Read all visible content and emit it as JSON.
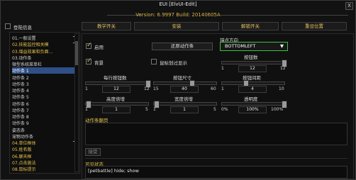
{
  "window": {
    "title": "EUI [ElvUI-Edit]",
    "close_label": "X",
    "version": "Version: 6.9997 Build: 20140605A"
  },
  "toggle_anchors": {
    "label": "登陆信息"
  },
  "top_buttons": [
    "教学开关",
    "安装",
    "解锁开关",
    "重设位置"
  ],
  "nav": {
    "items": [
      {
        "label": "01.一般设置",
        "color": "white",
        "plus": true
      },
      {
        "label": "02.技能监控相关模",
        "color": "yellow",
        "plus": true
      },
      {
        "label": "03.增益效果和负面...",
        "color": "yellow",
        "plus": false
      },
      {
        "label": "03.动作条",
        "color": "white",
        "plus": false
      },
      {
        "label": "微型系统菜单栏",
        "color": "white",
        "plus": false
      },
      {
        "label": "动作条 1",
        "color": "white",
        "plus": false,
        "selected": true
      },
      {
        "label": "动作条 2",
        "color": "white",
        "plus": false
      },
      {
        "label": "动作条 3",
        "color": "white",
        "plus": false
      },
      {
        "label": "动作条 4",
        "color": "white",
        "plus": false
      },
      {
        "label": "动作条 5",
        "color": "white",
        "plus": false
      },
      {
        "label": "动作条 6",
        "color": "white",
        "plus": false
      },
      {
        "label": "动作条 7",
        "color": "white",
        "plus": false
      },
      {
        "label": "动作条 8",
        "color": "white",
        "plus": false
      },
      {
        "label": "动作条 9",
        "color": "white",
        "plus": false
      },
      {
        "label": "姿态条",
        "color": "white",
        "plus": false
      },
      {
        "label": "宠物动作条",
        "color": "white",
        "plus": false
      },
      {
        "label": "04.单位框体",
        "color": "yellow",
        "plus": true
      },
      {
        "label": "05.姓名版",
        "color": "yellow",
        "plus": false
      },
      {
        "label": "06.聊天框",
        "color": "yellow",
        "plus": false
      },
      {
        "label": "07.点击施法",
        "color": "yellow",
        "plus": false
      },
      {
        "label": "08.鼠标提示",
        "color": "yellow",
        "plus": false
      }
    ]
  },
  "options": {
    "enable_label": "启用",
    "backdrop_label": "背景",
    "mouseover_label": "鼠标划过显示",
    "restore_button": "还原动作条",
    "anchor": {
      "label": "锚点方向",
      "value": "BOTTOMLEFT",
      "arrow": "▼"
    },
    "buttons_slider": {
      "label": "按钮数",
      "min": "1",
      "max": "12",
      "value": "12"
    },
    "per_row": {
      "label": "每行按钮数",
      "min": "1",
      "max": "12",
      "value": "12"
    },
    "button_size": {
      "label": "按钮尺寸",
      "min": "15",
      "max": "60",
      "value": "40"
    },
    "spacing": {
      "label": "按钮间距",
      "min": "1",
      "max": "10",
      "value": "4"
    },
    "height_mult": {
      "label": "高度倍增",
      "min": "1",
      "max": "5",
      "value": "1"
    },
    "width_mult": {
      "label": "宽度倍增",
      "min": "1",
      "max": "5",
      "value": "1"
    },
    "alpha": {
      "label": "透明度",
      "min": "0%",
      "max": "100%",
      "value": "100%"
    }
  },
  "paging": {
    "label": "动作条翻页",
    "accept": "接受"
  },
  "visibility": {
    "label": "可见状态",
    "value": "[petbattle] hide; show"
  }
}
